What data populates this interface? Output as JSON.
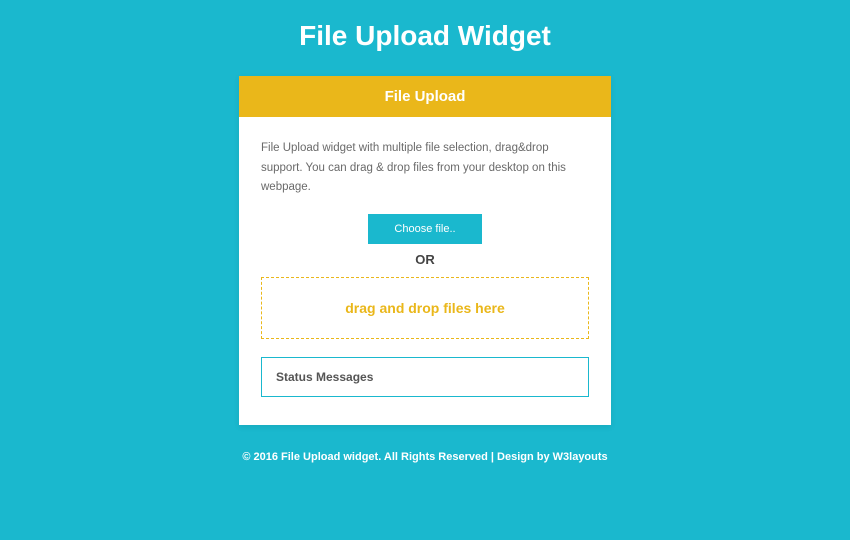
{
  "page": {
    "title": "File Upload Widget"
  },
  "card": {
    "header": "File Upload",
    "description": "File Upload widget with multiple file selection, drag&drop support. You can drag & drop files from your desktop on this webpage.",
    "choose_button_label": "Choose file..",
    "or_label": "OR",
    "dropzone_label": "drag and drop files here",
    "status_label": "Status Messages"
  },
  "footer": {
    "copyright": "© 2016 File Upload widget. All Rights Reserved | Design by ",
    "link_label": "W3layouts"
  }
}
